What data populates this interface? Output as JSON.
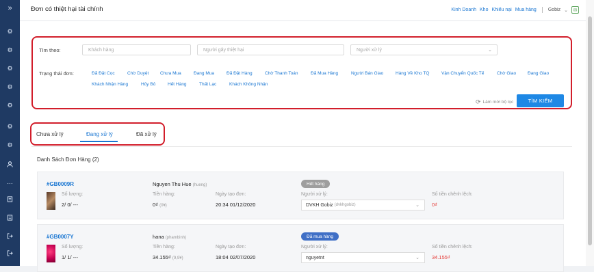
{
  "page": {
    "title": "Đơn có thiệt hại tài chính"
  },
  "topnav": {
    "links": [
      "Kinh Doanh",
      "Kho",
      "Khiếu nại",
      "Mua hàng"
    ],
    "user": "Gobiz"
  },
  "sidebar": {
    "icons": [
      "expand-icon",
      "settings-icon",
      "settings-icon",
      "settings-icon",
      "settings-icon",
      "settings-icon",
      "settings-icon",
      "settings-icon",
      "user-icon",
      "more-icon",
      "document-icon",
      "document-icon",
      "logout-icon",
      "logout-icon"
    ]
  },
  "filter": {
    "search_label": "Tìm theo:",
    "customer_placeholder": "Khách hàng",
    "damager_placeholder": "Người gây thiệt hại",
    "handler_placeholder": "Người xử lý",
    "status_label": "Trạng thái đơn:",
    "statuses_row1": [
      "Đã Đặt Cọc",
      "Chờ Duyệt",
      "Chưa Mua",
      "Đang Mua",
      "Đã Đặt Hàng",
      "Chờ Thanh Toán",
      "Đã Mua Hàng",
      "Người Bán Giao",
      "Hàng Về Kho TQ",
      "Vận Chuyển Quốc Tế",
      "Chờ Giao",
      "Đang Giao"
    ],
    "statuses_row2": [
      "Khách Nhận Hàng",
      "Hủy Bỏ",
      "Hết Hàng",
      "Thất Lạc",
      "Khách Không Nhận"
    ],
    "reset_label": "Làm mới bộ lọc",
    "search_button": "TÌM KIẾM"
  },
  "tabs": [
    {
      "label": "Chưa xử lý"
    },
    {
      "label": "Đang xử lý"
    },
    {
      "label": "Đã xử lý"
    }
  ],
  "list": {
    "title": "Danh Sách Đơn Hàng",
    "count": "(2)"
  },
  "labels": {
    "qty": "Số lượng:",
    "goods": "Tiền hàng:",
    "created": "Ngày tạo đơn:",
    "handler": "Người xử lý:",
    "diff": "Số tiền chênh lệch:"
  },
  "orders": [
    {
      "id": "#GB0009R",
      "customer": "Nguyen Thu Hue",
      "username": "(hueng)",
      "qty": "2/ 0/ ---",
      "goods": "0₫",
      "goods_sub": "(0¥)",
      "created": "20:34 01/12/2020",
      "status": "Hết hàng",
      "status_color": "#9e9e9e",
      "handler": "DVKH Gobiz",
      "handler_sub": "(dvkhgobiz)",
      "diff": "0₫"
    },
    {
      "id": "#GB0007Y",
      "customer": "hana",
      "username": "(phambinh)",
      "qty": "1/ 1/ ---",
      "goods": "34.155₫",
      "goods_sub": "(9,9¥)",
      "created": "18:04 02/07/2020",
      "status": "Đã mua hàng",
      "status_color": "#3f6fc6",
      "handler": "nguyetnt",
      "handler_sub": "",
      "diff": "34.155₫"
    }
  ]
}
